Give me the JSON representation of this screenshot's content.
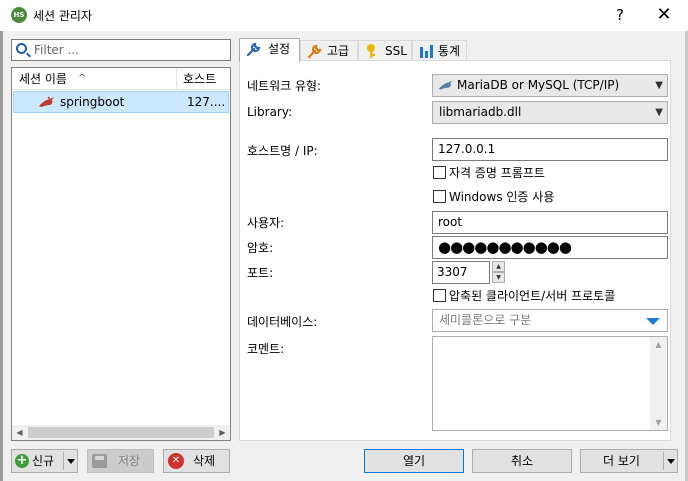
{
  "window": {
    "app_icon_text": "HS",
    "title": "세션 관리자",
    "help_label": "?",
    "close_label": "✕"
  },
  "filter": {
    "placeholder": "Filter ...",
    "icon": "search-icon"
  },
  "session_list": {
    "columns": [
      "세션 이름",
      "호스트"
    ],
    "sort_indicator": "^",
    "rows": [
      {
        "name": "springboot",
        "host": "127....",
        "icon": "dolphin-icon",
        "selected": true
      }
    ]
  },
  "tabs": [
    {
      "label": "설정",
      "icon": "wrench-icon",
      "active": true
    },
    {
      "label": "고급",
      "icon": "wrench-orange-icon",
      "active": false
    },
    {
      "label": "SSL",
      "icon": "key-icon",
      "active": false
    },
    {
      "label": "통계",
      "icon": "bar-chart-icon",
      "active": false
    }
  ],
  "settings": {
    "network_type_label": "네트워크 유형:",
    "network_type_value": "MariaDB or MySQL (TCP/IP)",
    "library_label": "Library:",
    "library_value": "libmariadb.dll",
    "host_label": "호스트명 / IP:",
    "host_value": "127.0.0.1",
    "prompt_credentials_label": "자격 증명 프롬프트",
    "prompt_credentials_checked": false,
    "windows_auth_label": "Windows 인증 사용",
    "windows_auth_checked": false,
    "user_label": "사용자:",
    "user_value": "root",
    "password_label": "암호:",
    "password_value": "●●●●●●●●●●●",
    "port_label": "포트:",
    "port_value": "3307",
    "compressed_label": "압축된 클라이언트/서버 프로토콜",
    "compressed_checked": false,
    "databases_label": "데이터베이스:",
    "databases_placeholder": "세미콜론으로 구분",
    "comment_label": "코멘트:",
    "comment_value": ""
  },
  "buttons": {
    "new": "신규",
    "save": "저장",
    "delete": "삭제",
    "open": "열기",
    "cancel": "취소",
    "more": "더 보기"
  },
  "colors": {
    "selection": "#cce8ff",
    "accent": "#0078d7",
    "new_green": "#3a9d3a",
    "delete_red": "#d32f2f"
  }
}
